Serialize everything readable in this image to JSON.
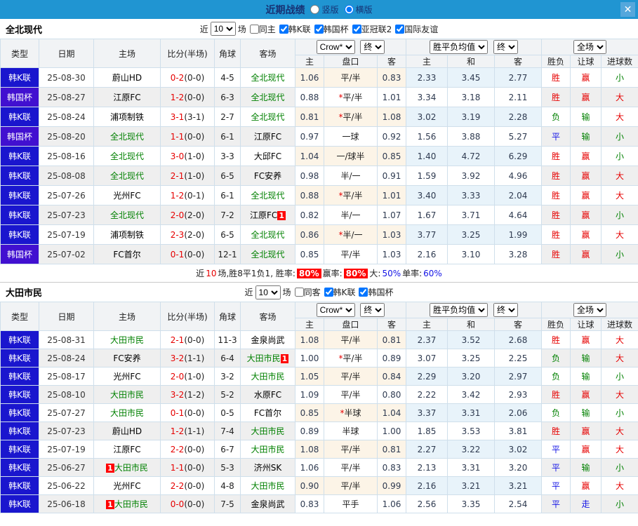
{
  "titlebar": {
    "title": "近期战绩",
    "radio_vertical": "竖版",
    "radio_horizontal": "横版",
    "close_glyph": "✕"
  },
  "headers": {
    "type": "类型",
    "date": "日期",
    "home": "主场",
    "score": "比分(半场)",
    "corner": "角球",
    "away": "客场",
    "crow_home": "主",
    "crow_handicap": "盘口",
    "crow_away": "客",
    "avg_home": "主",
    "avg_draw": "和",
    "avg_away": "客",
    "result_wdl": "胜负",
    "result_handicap": "让球",
    "result_goals": "进球数",
    "select_crow": "Crow*",
    "select_final_1": "终",
    "select_avg": "胜平负均值",
    "select_final_2": "终",
    "select_fullmatch": "全场"
  },
  "filter_labels": {
    "near": "近",
    "games": "场"
  },
  "colors": {
    "topbar": "#2095d2",
    "close_button": "#54a7dc",
    "title_text": "#173173",
    "league_kleague": "#1a16ce",
    "league_cup": "#4110d0",
    "focal_team": "#008000",
    "score_red": "#e60000",
    "win_red": "#e60000",
    "lose_green": "#008000",
    "draw_blue": "#1414e6",
    "row_alt_grey": "#efefef",
    "crow_tint": "#fcf4e7",
    "avg_tint": "#e8f3fa",
    "summary_box_red": "#ff0000"
  },
  "sections": [
    {
      "team": "全北现代",
      "filter": {
        "count": "10",
        "checkboxes": [
          {
            "label": "同主",
            "checked": false
          },
          {
            "label": "韩K联",
            "checked": true
          },
          {
            "label": "韩国杯",
            "checked": true
          },
          {
            "label": "亚冠联2",
            "checked": true
          },
          {
            "label": "国际友谊",
            "checked": true
          }
        ]
      },
      "rows": [
        {
          "league": "韩K联",
          "league_type": "k",
          "date": "25-08-30",
          "home": {
            "name": "蔚山HD"
          },
          "score": "0-2",
          "half": "(0-0)",
          "corner": "4-5",
          "away": {
            "name": "全北现代",
            "focal": true
          },
          "crow": [
            "1.06",
            "平/半",
            "0.83"
          ],
          "avg": [
            "2.33",
            "3.45",
            "2.77"
          ],
          "results": [
            [
              "胜",
              "r"
            ],
            [
              "赢",
              "r"
            ],
            [
              "小",
              "g"
            ]
          ]
        },
        {
          "league": "韩国杯",
          "league_type": "c",
          "date": "25-08-27",
          "home": {
            "name": "江原FC"
          },
          "score": "1-2",
          "half": "(0-0)",
          "corner": "6-3",
          "away": {
            "name": "全北现代",
            "focal": true
          },
          "crow": [
            "0.88",
            "*平/半",
            "1.01"
          ],
          "avg": [
            "3.34",
            "3.18",
            "2.11"
          ],
          "results": [
            [
              "胜",
              "r"
            ],
            [
              "赢",
              "r"
            ],
            [
              "大",
              "r"
            ]
          ]
        },
        {
          "league": "韩K联",
          "league_type": "k",
          "date": "25-08-24",
          "home": {
            "name": "浦项制铁"
          },
          "score": "3-1",
          "half": "(3-1)",
          "corner": "2-7",
          "away": {
            "name": "全北现代",
            "focal": true
          },
          "crow": [
            "0.81",
            "*平/半",
            "1.08"
          ],
          "avg": [
            "3.02",
            "3.19",
            "2.28"
          ],
          "results": [
            [
              "负",
              "g"
            ],
            [
              "输",
              "g"
            ],
            [
              "大",
              "r"
            ]
          ]
        },
        {
          "league": "韩国杯",
          "league_type": "c",
          "date": "25-08-20",
          "home": {
            "name": "全北现代",
            "focal": true
          },
          "score": "1-1",
          "half": "(0-0)",
          "corner": "6-1",
          "away": {
            "name": "江原FC"
          },
          "crow": [
            "0.97",
            "一球",
            "0.92"
          ],
          "avg": [
            "1.56",
            "3.88",
            "5.27"
          ],
          "results": [
            [
              "平",
              "b"
            ],
            [
              "输",
              "g"
            ],
            [
              "小",
              "g"
            ]
          ]
        },
        {
          "league": "韩K联",
          "league_type": "k",
          "date": "25-08-16",
          "home": {
            "name": "全北现代",
            "focal": true
          },
          "score": "3-0",
          "half": "(1-0)",
          "corner": "3-3",
          "away": {
            "name": "大邱FC"
          },
          "crow": [
            "1.04",
            "一/球半",
            "0.85"
          ],
          "avg": [
            "1.40",
            "4.72",
            "6.29"
          ],
          "results": [
            [
              "胜",
              "r"
            ],
            [
              "赢",
              "r"
            ],
            [
              "小",
              "g"
            ]
          ]
        },
        {
          "league": "韩K联",
          "league_type": "k",
          "date": "25-08-08",
          "home": {
            "name": "全北现代",
            "focal": true
          },
          "score": "2-1",
          "half": "(1-0)",
          "corner": "6-5",
          "away": {
            "name": "FC安养"
          },
          "crow": [
            "0.98",
            "半/一",
            "0.91"
          ],
          "avg": [
            "1.59",
            "3.92",
            "4.96"
          ],
          "results": [
            [
              "胜",
              "r"
            ],
            [
              "赢",
              "r"
            ],
            [
              "大",
              "r"
            ]
          ]
        },
        {
          "league": "韩K联",
          "league_type": "k",
          "date": "25-07-26",
          "home": {
            "name": "光州FC"
          },
          "score": "1-2",
          "half": "(0-1)",
          "corner": "6-1",
          "away": {
            "name": "全北现代",
            "focal": true
          },
          "crow": [
            "0.88",
            "*平/半",
            "1.01"
          ],
          "avg": [
            "3.40",
            "3.33",
            "2.04"
          ],
          "results": [
            [
              "胜",
              "r"
            ],
            [
              "赢",
              "r"
            ],
            [
              "大",
              "r"
            ]
          ]
        },
        {
          "league": "韩K联",
          "league_type": "k",
          "date": "25-07-23",
          "home": {
            "name": "全北现代",
            "focal": true
          },
          "score": "2-0",
          "half": "(2-0)",
          "corner": "7-2",
          "away": {
            "name": "江原FC",
            "badge": "1",
            "badge_pos": "after"
          },
          "crow": [
            "0.82",
            "半/一",
            "1.07"
          ],
          "avg": [
            "1.67",
            "3.71",
            "4.64"
          ],
          "results": [
            [
              "胜",
              "r"
            ],
            [
              "赢",
              "r"
            ],
            [
              "小",
              "g"
            ]
          ]
        },
        {
          "league": "韩K联",
          "league_type": "k",
          "date": "25-07-19",
          "home": {
            "name": "浦项制铁"
          },
          "score": "2-3",
          "half": "(2-0)",
          "corner": "6-5",
          "away": {
            "name": "全北现代",
            "focal": true
          },
          "crow": [
            "0.86",
            "*半/一",
            "1.03"
          ],
          "avg": [
            "3.77",
            "3.25",
            "1.99"
          ],
          "results": [
            [
              "胜",
              "r"
            ],
            [
              "赢",
              "r"
            ],
            [
              "大",
              "r"
            ]
          ]
        },
        {
          "league": "韩国杯",
          "league_type": "c",
          "date": "25-07-02",
          "home": {
            "name": "FC首尔"
          },
          "score": "0-1",
          "half": "(0-0)",
          "corner": "12-1",
          "away": {
            "name": "全北现代",
            "focal": true
          },
          "crow": [
            "0.85",
            "平/半",
            "1.03"
          ],
          "avg": [
            "2.16",
            "3.10",
            "3.28"
          ],
          "results": [
            [
              "胜",
              "r"
            ],
            [
              "赢",
              "r"
            ],
            [
              "小",
              "g"
            ]
          ]
        }
      ],
      "summary": [
        {
          "text": "近",
          "style": "plain"
        },
        {
          "text": "10",
          "style": "red"
        },
        {
          "text": "场,胜8平1负1, 胜率:",
          "style": "plain"
        },
        {
          "text": "80%",
          "style": "redbox"
        },
        {
          "text": "赢率:",
          "style": "plain"
        },
        {
          "text": "80%",
          "style": "redbox"
        },
        {
          "text": "大:",
          "style": "plain"
        },
        {
          "text": "50%",
          "style": "blue"
        },
        {
          "text": "单率:",
          "style": "plain"
        },
        {
          "text": "60%",
          "style": "blue"
        }
      ]
    },
    {
      "team": "大田市民",
      "filter": {
        "count": "10",
        "checkboxes": [
          {
            "label": "同客",
            "checked": false
          },
          {
            "label": "韩K联",
            "checked": true
          },
          {
            "label": "韩国杯",
            "checked": true
          }
        ]
      },
      "rows": [
        {
          "league": "韩K联",
          "league_type": "k",
          "date": "25-08-31",
          "home": {
            "name": "大田市民",
            "focal": true
          },
          "score": "2-1",
          "half": "(0-0)",
          "corner": "11-3",
          "away": {
            "name": "金泉尚武"
          },
          "crow": [
            "1.08",
            "平/半",
            "0.81"
          ],
          "avg": [
            "2.37",
            "3.52",
            "2.68"
          ],
          "results": [
            [
              "胜",
              "r"
            ],
            [
              "赢",
              "r"
            ],
            [
              "大",
              "r"
            ]
          ]
        },
        {
          "league": "韩K联",
          "league_type": "k",
          "date": "25-08-24",
          "home": {
            "name": "FC安养"
          },
          "score": "3-2",
          "half": "(1-1)",
          "corner": "6-4",
          "away": {
            "name": "大田市民",
            "focal": true,
            "badge": "1",
            "badge_pos": "after"
          },
          "crow": [
            "1.00",
            "*平/半",
            "0.89"
          ],
          "avg": [
            "3.07",
            "3.25",
            "2.25"
          ],
          "results": [
            [
              "负",
              "g"
            ],
            [
              "输",
              "g"
            ],
            [
              "大",
              "r"
            ]
          ]
        },
        {
          "league": "韩K联",
          "league_type": "k",
          "date": "25-08-17",
          "home": {
            "name": "光州FC"
          },
          "score": "2-0",
          "half": "(1-0)",
          "corner": "3-2",
          "away": {
            "name": "大田市民",
            "focal": true
          },
          "crow": [
            "1.05",
            "平/半",
            "0.84"
          ],
          "avg": [
            "2.29",
            "3.20",
            "2.97"
          ],
          "results": [
            [
              "负",
              "g"
            ],
            [
              "输",
              "g"
            ],
            [
              "小",
              "g"
            ]
          ]
        },
        {
          "league": "韩K联",
          "league_type": "k",
          "date": "25-08-10",
          "home": {
            "name": "大田市民",
            "focal": true
          },
          "score": "3-2",
          "half": "(1-2)",
          "corner": "5-2",
          "away": {
            "name": "水原FC"
          },
          "crow": [
            "1.09",
            "平/半",
            "0.80"
          ],
          "avg": [
            "2.22",
            "3.42",
            "2.93"
          ],
          "results": [
            [
              "胜",
              "r"
            ],
            [
              "赢",
              "r"
            ],
            [
              "大",
              "r"
            ]
          ]
        },
        {
          "league": "韩K联",
          "league_type": "k",
          "date": "25-07-27",
          "home": {
            "name": "大田市民",
            "focal": true
          },
          "score": "0-1",
          "half": "(0-0)",
          "corner": "0-5",
          "away": {
            "name": "FC首尔"
          },
          "crow": [
            "0.85",
            "*半球",
            "1.04"
          ],
          "avg": [
            "3.37",
            "3.31",
            "2.06"
          ],
          "results": [
            [
              "负",
              "g"
            ],
            [
              "输",
              "g"
            ],
            [
              "小",
              "g"
            ]
          ]
        },
        {
          "league": "韩K联",
          "league_type": "k",
          "date": "25-07-23",
          "home": {
            "name": "蔚山HD"
          },
          "score": "1-2",
          "half": "(1-1)",
          "corner": "7-4",
          "away": {
            "name": "大田市民",
            "focal": true
          },
          "crow": [
            "0.89",
            "半球",
            "1.00"
          ],
          "avg": [
            "1.85",
            "3.53",
            "3.81"
          ],
          "results": [
            [
              "胜",
              "r"
            ],
            [
              "赢",
              "r"
            ],
            [
              "大",
              "r"
            ]
          ]
        },
        {
          "league": "韩K联",
          "league_type": "k",
          "date": "25-07-19",
          "home": {
            "name": "江原FC"
          },
          "score": "2-2",
          "half": "(0-0)",
          "corner": "6-7",
          "away": {
            "name": "大田市民",
            "focal": true
          },
          "crow": [
            "1.08",
            "平/半",
            "0.81"
          ],
          "avg": [
            "2.27",
            "3.22",
            "3.02"
          ],
          "results": [
            [
              "平",
              "b"
            ],
            [
              "赢",
              "r"
            ],
            [
              "大",
              "r"
            ]
          ]
        },
        {
          "league": "韩K联",
          "league_type": "k",
          "date": "25-06-27",
          "home": {
            "name": "大田市民",
            "focal": true,
            "badge": "1",
            "badge_pos": "before"
          },
          "score": "1-1",
          "half": "(0-0)",
          "corner": "5-3",
          "away": {
            "name": "济州SK"
          },
          "crow": [
            "1.06",
            "平/半",
            "0.83"
          ],
          "avg": [
            "2.13",
            "3.31",
            "3.20"
          ],
          "results": [
            [
              "平",
              "b"
            ],
            [
              "输",
              "g"
            ],
            [
              "小",
              "g"
            ]
          ]
        },
        {
          "league": "韩K联",
          "league_type": "k",
          "date": "25-06-22",
          "home": {
            "name": "光州FC"
          },
          "score": "2-2",
          "half": "(0-0)",
          "corner": "4-8",
          "away": {
            "name": "大田市民",
            "focal": true
          },
          "crow": [
            "0.90",
            "平/半",
            "0.99"
          ],
          "avg": [
            "2.16",
            "3.21",
            "3.21"
          ],
          "results": [
            [
              "平",
              "b"
            ],
            [
              "赢",
              "r"
            ],
            [
              "大",
              "r"
            ]
          ]
        },
        {
          "league": "韩K联",
          "league_type": "k",
          "date": "25-06-18",
          "home": {
            "name": "大田市民",
            "focal": true,
            "badge": "1",
            "badge_pos": "before"
          },
          "score": "0-0",
          "half": "(0-0)",
          "corner": "7-5",
          "away": {
            "name": "金泉尚武"
          },
          "crow": [
            "0.83",
            "平手",
            "1.06"
          ],
          "avg": [
            "2.56",
            "3.35",
            "2.54"
          ],
          "results": [
            [
              "平",
              "b"
            ],
            [
              "走",
              "b"
            ],
            [
              "小",
              "g"
            ]
          ]
        }
      ],
      "summary": null
    }
  ]
}
